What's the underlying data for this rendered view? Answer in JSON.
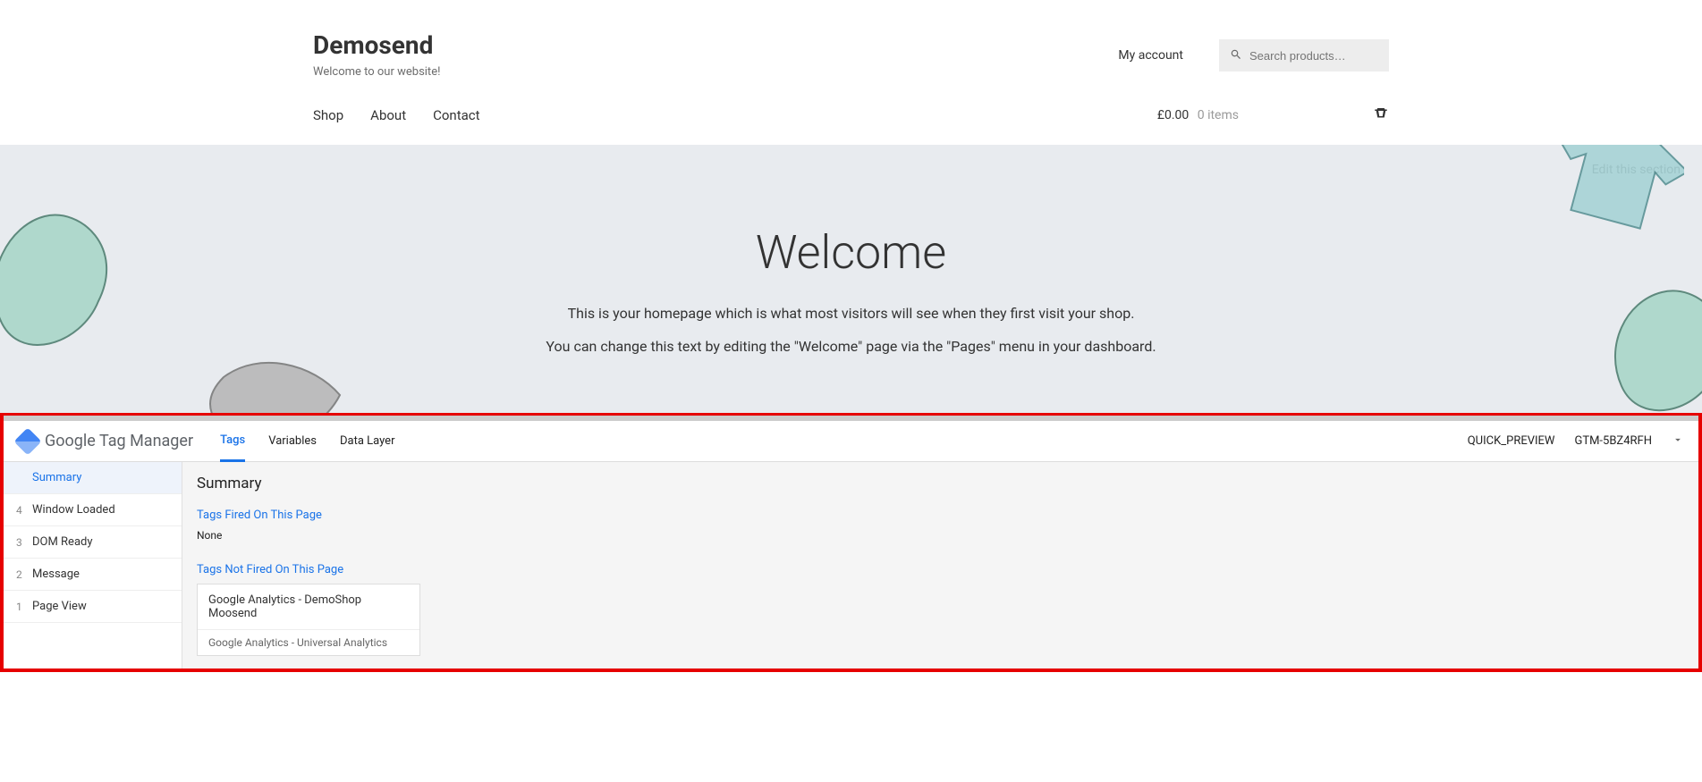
{
  "site": {
    "title": "Demosend",
    "tagline": "Welcome to our website!",
    "my_account": "My account",
    "search_placeholder": "Search products…",
    "nav": [
      "Shop",
      "About",
      "Contact"
    ],
    "cart_price": "£0.00",
    "cart_items": "0 items"
  },
  "hero": {
    "edit_link": "Edit this section",
    "heading": "Welcome",
    "line1": "This is your homepage which is what most visitors will see when they first visit your shop.",
    "line2": "You can change this text by editing the \"Welcome\" page via the \"Pages\" menu in your dashboard."
  },
  "gtm": {
    "brand_google": "Google",
    "brand_tm": "Tag Manager",
    "tabs": [
      "Tags",
      "Variables",
      "Data Layer"
    ],
    "active_tab_index": 0,
    "header_mode": "QUICK_PREVIEW",
    "container_id": "GTM-5BZ4RFH",
    "sidebar": [
      {
        "num": "",
        "label": "Summary",
        "selected": true
      },
      {
        "num": "4",
        "label": "Window Loaded"
      },
      {
        "num": "3",
        "label": "DOM Ready"
      },
      {
        "num": "2",
        "label": "Message"
      },
      {
        "num": "1",
        "label": "Page View"
      }
    ],
    "main": {
      "title": "Summary",
      "fired_label": "Tags Fired On This Page",
      "fired_none": "None",
      "not_fired_label": "Tags Not Fired On This Page",
      "tag": {
        "name": "Google Analytics - DemoShop Moosend",
        "type": "Google Analytics - Universal Analytics"
      }
    }
  }
}
